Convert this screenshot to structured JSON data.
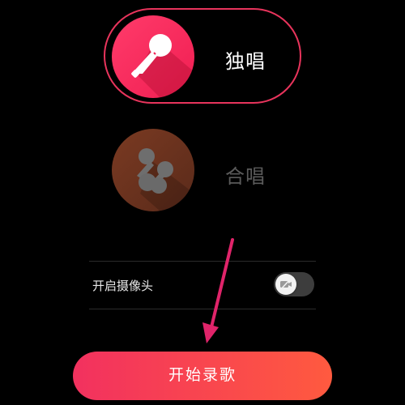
{
  "modes": {
    "solo": {
      "label": "独唱",
      "selected": true,
      "icon": "microphone-icon"
    },
    "chorus": {
      "label": "合唱",
      "selected": false,
      "icon": "duet-microphones-icon"
    }
  },
  "camera": {
    "label": "开启摄像头",
    "enabled": false,
    "icon": "camera-off-icon"
  },
  "start_button": {
    "label": "开始录歌"
  },
  "colors": {
    "accent": "#f01e52",
    "gradient_end": "#ff5a3f",
    "annotation_arrow": "#e0246a"
  }
}
